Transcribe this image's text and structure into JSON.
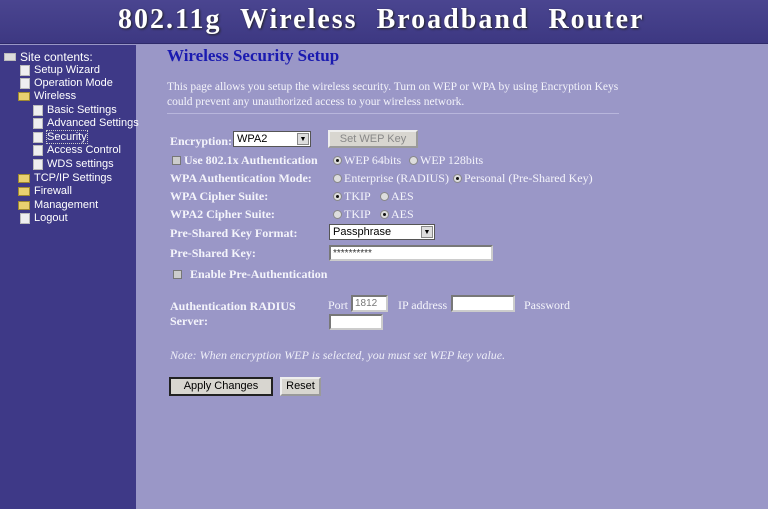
{
  "header": {
    "title": "802.11g Wireless Broadband Router"
  },
  "sidebar": {
    "title": "Site contents:",
    "items": [
      {
        "label": "Setup Wizard",
        "icon": "page-icon"
      },
      {
        "label": "Operation Mode",
        "icon": "page-icon"
      },
      {
        "label": "Wireless",
        "icon": "folder-open-icon"
      },
      {
        "label": "Basic Settings",
        "icon": "page-icon"
      },
      {
        "label": "Advanced Settings",
        "icon": "page-icon"
      },
      {
        "label": "Security",
        "icon": "page-icon",
        "selected": true
      },
      {
        "label": "Access Control",
        "icon": "page-icon"
      },
      {
        "label": "WDS settings",
        "icon": "page-icon"
      },
      {
        "label": "TCP/IP Settings",
        "icon": "folder-icon"
      },
      {
        "label": "Firewall",
        "icon": "folder-icon"
      },
      {
        "label": "Management",
        "icon": "folder-icon"
      },
      {
        "label": "Logout",
        "icon": "page-icon"
      }
    ]
  },
  "main": {
    "title": "Wireless Security Setup",
    "description": "This page allows you setup the wireless security. Turn on WEP or WPA by using Encryption Keys could prevent any unauthorized access to your wireless network.",
    "encryption_label": "Encryption:",
    "encryption_value": "WPA2",
    "set_wep_key": "Set WEP Key",
    "use_8021x": "Use 802.1x Authentication",
    "wep64": "WEP 64bits",
    "wep128": "WEP 128bits",
    "wpa_auth_label": "WPA Authentication Mode:",
    "enterprise": "Enterprise (RADIUS)",
    "personal": "Personal (Pre-Shared Key)",
    "wpa_cipher_label": "WPA Cipher Suite:",
    "wpa2_cipher_label": "WPA2 Cipher Suite:",
    "tkip": "TKIP",
    "aes": "AES",
    "psk_format_label": "Pre-Shared Key Format:",
    "psk_format_value": "Passphrase",
    "psk_label": "Pre-Shared Key:",
    "psk_value": "**********",
    "preauth": "Enable Pre-Authentication",
    "radius_label_1": "Authentication RADIUS",
    "radius_label_2": "Server:",
    "port_label": "Port",
    "port_value": "1812",
    "ip_label": "IP address",
    "password_label": "Password",
    "note": "Note: When encryption WEP is selected, you must set WEP key value.",
    "apply": "Apply Changes",
    "reset": "Reset"
  }
}
